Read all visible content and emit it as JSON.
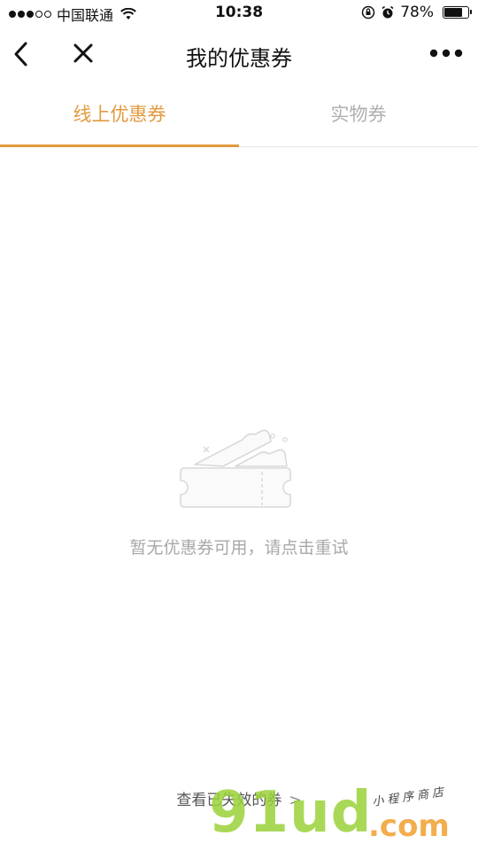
{
  "status_bar": {
    "signal_filled": 3,
    "signal_total": 5,
    "carrier": "中国联通",
    "time": "10:38",
    "battery_percent": "78%",
    "battery_level": 0.78
  },
  "nav": {
    "title": "我的优惠券",
    "back_icon": "chevron-left-icon",
    "close_icon": "close-icon",
    "more_icon": "more-dots-icon"
  },
  "tabs": [
    {
      "label": "线上优惠券",
      "active": true
    },
    {
      "label": "实物券",
      "active": false
    }
  ],
  "empty_state": {
    "icon": "empty-ticket-icon",
    "message": "暂无优惠券可用，请点击重试"
  },
  "footer": {
    "expired_link": "查看已失效的券",
    "chevron": ">"
  },
  "watermark": {
    "main": "91ud",
    "dotcom": ".com",
    "sub": "小程序商店"
  },
  "colors": {
    "accent": "#e29a3e",
    "inactive_tab": "#b0b0b0",
    "muted_text": "#a8a8a8"
  }
}
